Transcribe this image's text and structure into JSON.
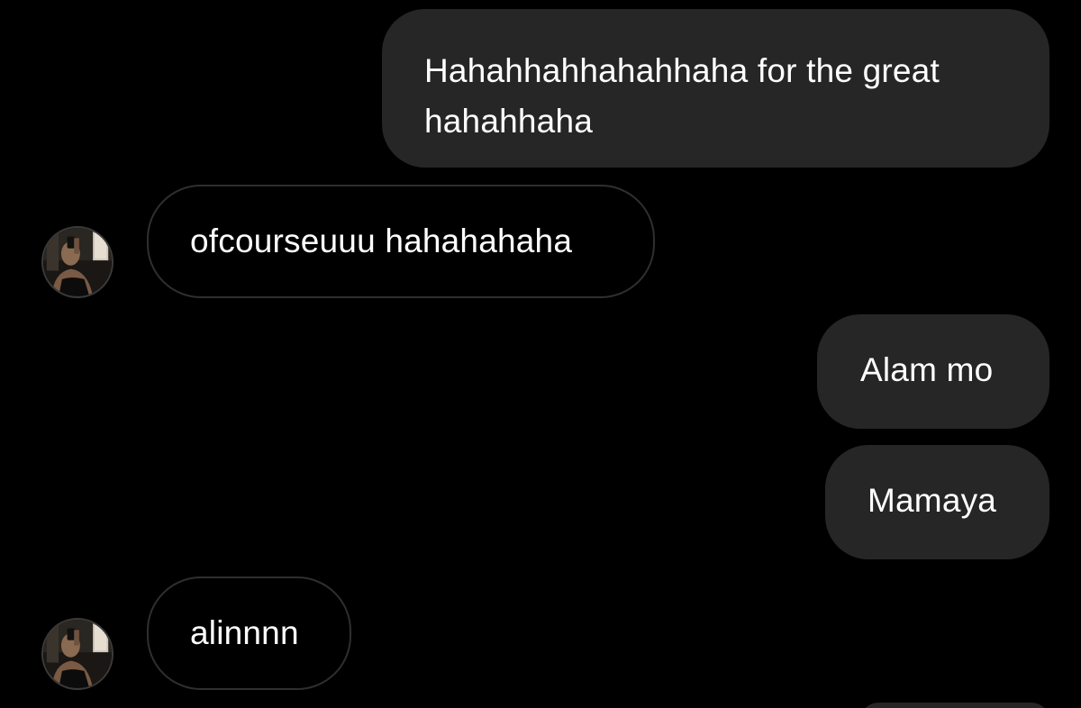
{
  "messages": [
    {
      "direction": "sent",
      "text": "Hahahhahhahahhaha for the great hahahhaha"
    },
    {
      "direction": "received",
      "text": "ofcourseuuu hahahahaha"
    },
    {
      "direction": "sent",
      "text": "Alam mo"
    },
    {
      "direction": "sent",
      "text": "Mamaya"
    },
    {
      "direction": "received",
      "text": "alinnnn"
    }
  ],
  "colors": {
    "background": "#000000",
    "sent_bubble": "#262626",
    "received_border": "#2f2f2f",
    "text": "#ffffff"
  },
  "icons": {
    "avatar": "contact-avatar-photo"
  }
}
